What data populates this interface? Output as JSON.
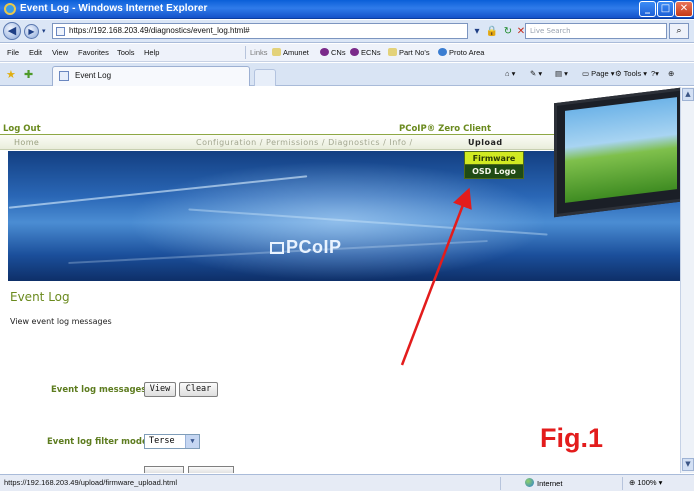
{
  "window": {
    "title": "Event Log - Windows Internet Explorer",
    "controls": {
      "minimize": "_",
      "restore": "□",
      "close": "✕"
    }
  },
  "address": {
    "url": "https://192.168.203.49/diagnostics/event_log.html#",
    "search_placeholder": "Live Search"
  },
  "menu": {
    "items": [
      "File",
      "Edit",
      "View",
      "Favorites",
      "Tools",
      "Help"
    ],
    "links_label": "Links",
    "links": [
      "Amunet",
      "CNs",
      "ECNs",
      "Part No's",
      "Proto Area"
    ]
  },
  "tabs": {
    "active_label": "Event Log",
    "commands": {
      "page": "Page",
      "tools": "Tools"
    }
  },
  "page": {
    "logout": "Log Out",
    "product": "PCoIP® Zero Client",
    "nav": {
      "home": "Home",
      "links": "Configuration  /  Permissions  /  Diagnostics  /  Info  /",
      "upload": "Upload"
    },
    "dropdown": [
      "Firmware",
      "OSD Logo"
    ],
    "banner_logo": "PCoIP",
    "section_title": "Event Log",
    "description": "View event log messages",
    "messages_label": "Event log messages:",
    "view_button": "View",
    "clear_button": "Clear",
    "filter_label": "Event log filter mode:",
    "filter_value": "Terse",
    "figure_label": "Fig.1"
  },
  "status": {
    "url": "https://192.168.203.49/upload/firmware_upload.html",
    "zone": "Internet",
    "zoom": "100%"
  },
  "colors": {
    "titlebar": "#1f62d6",
    "page_green": "#6a8a1e",
    "highlight": "#d1ea22",
    "annotation_red": "#e31c1c"
  }
}
